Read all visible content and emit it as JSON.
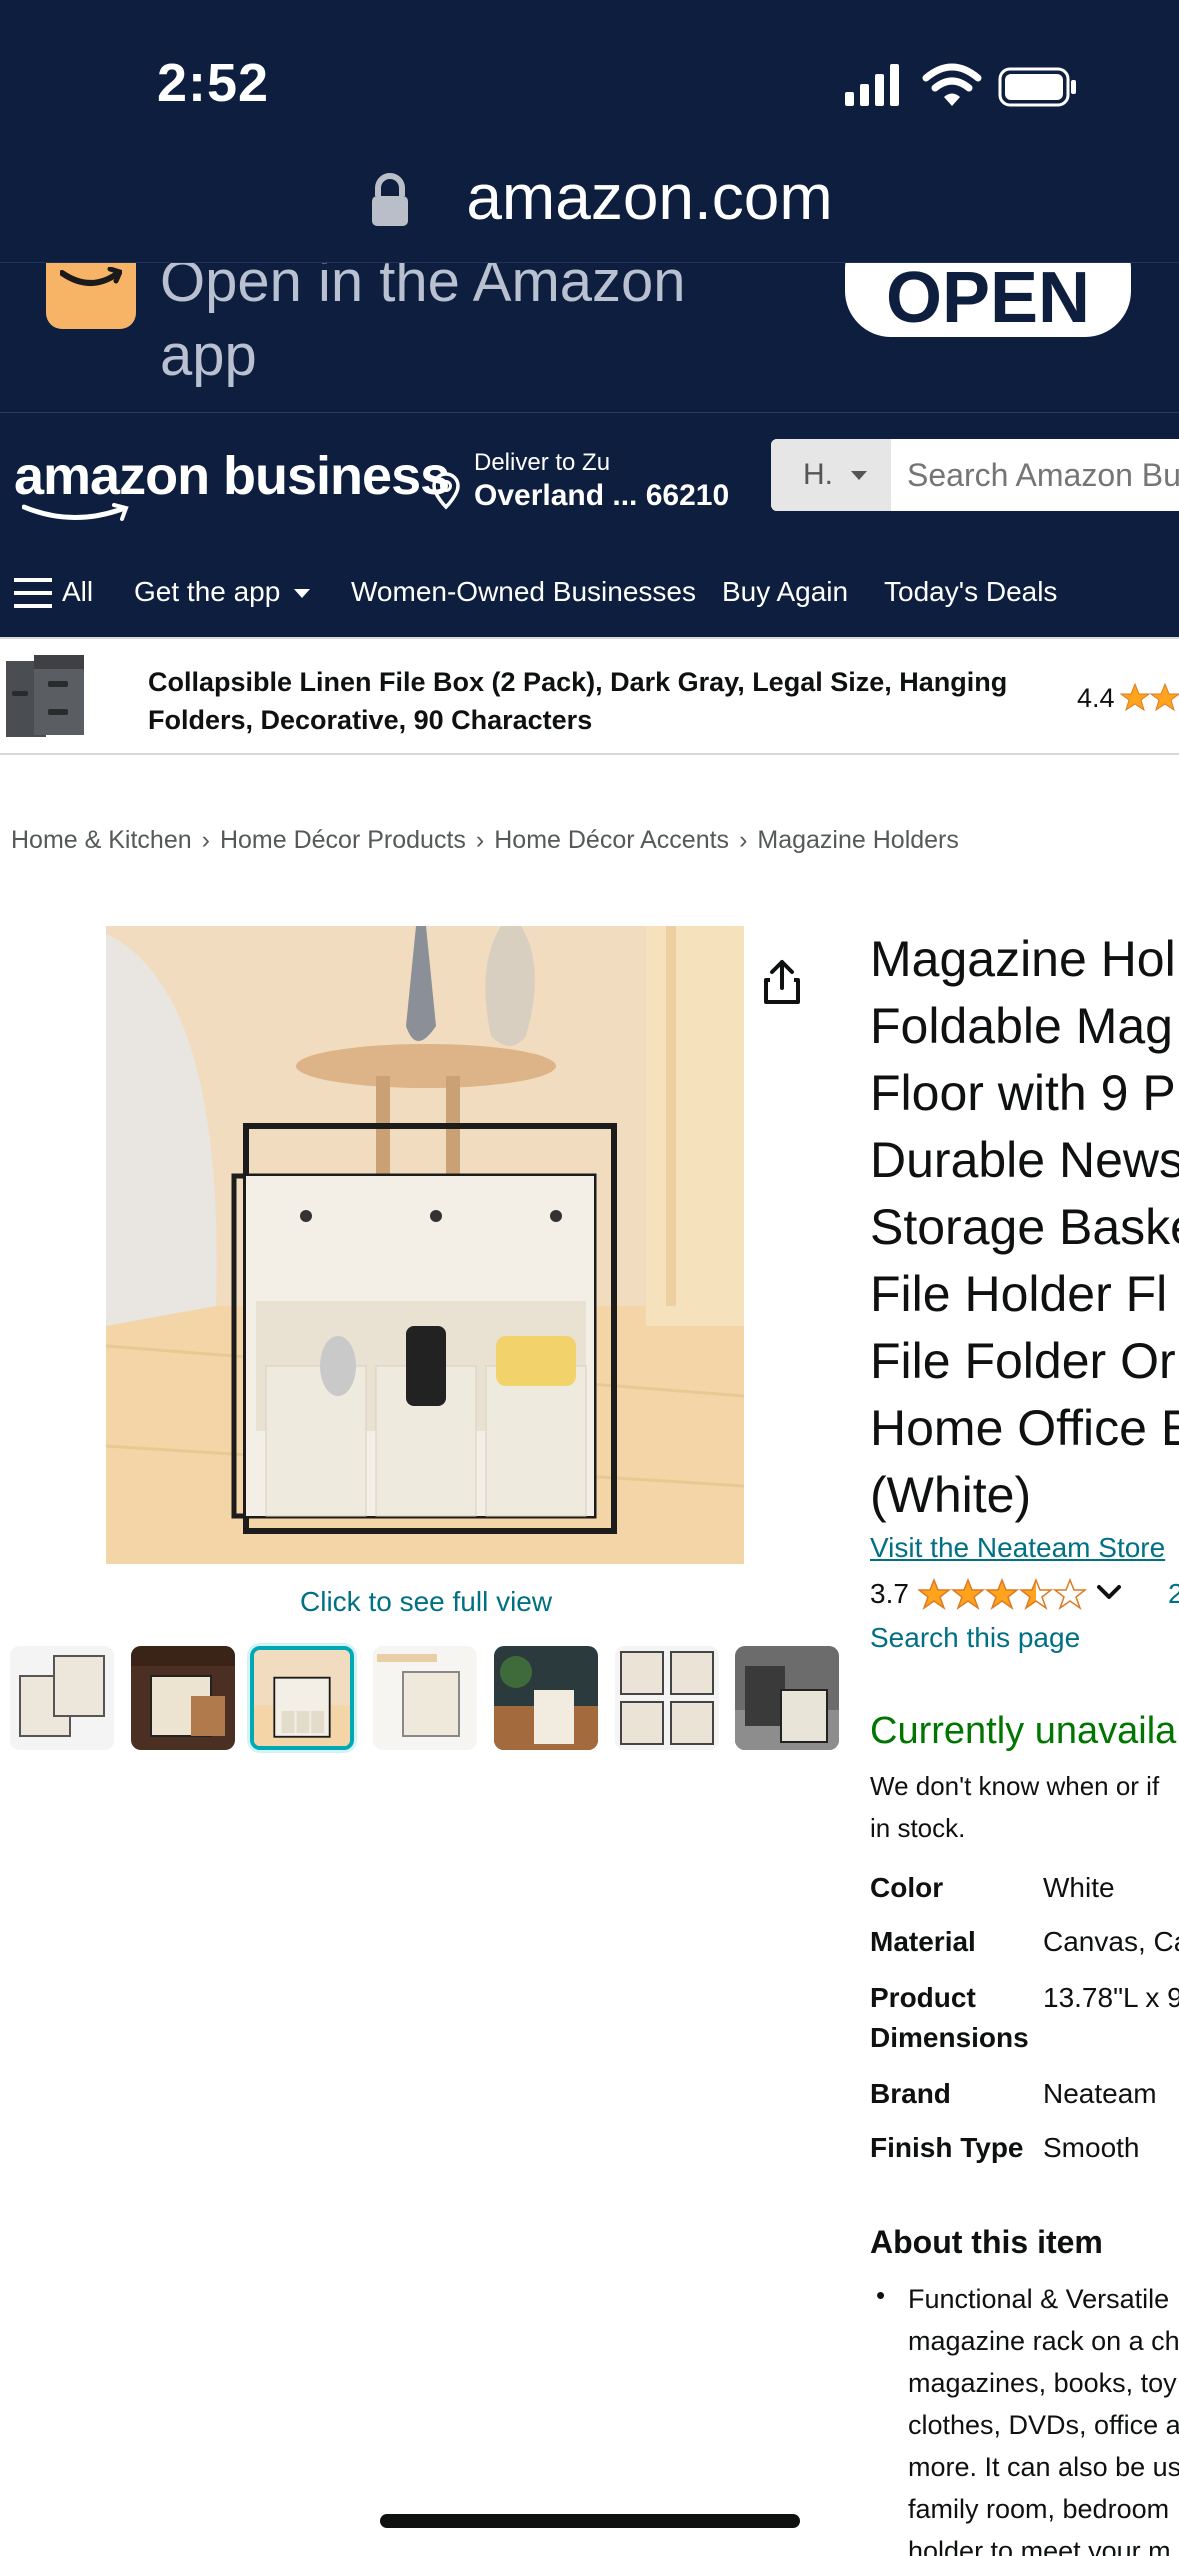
{
  "status_bar": {
    "time": "2:52"
  },
  "browser": {
    "url": "amazon.com"
  },
  "app_banner": {
    "text_line1": "Open in the Amazon",
    "text_line2": "app",
    "button": "OPEN"
  },
  "header": {
    "logo_text": "amazon business",
    "deliver_to": "Deliver to Zu",
    "location": "Overland ... 66210",
    "search_department": "H.",
    "search_placeholder": "Search Amazon Bu"
  },
  "nav": {
    "all": "All",
    "items": [
      "Get the app",
      "Women-Owned Businesses",
      "Buy Again",
      "Today's Deals"
    ]
  },
  "sticky_product": {
    "title_line1": "Collapsible Linen File Box (2 Pack), Dark Gray, Legal Size, Hanging",
    "title_line2": "Folders, Decorative, 90 Characters",
    "rating": "4.4"
  },
  "breadcrumb": [
    "Home & Kitchen",
    "Home Décor Products",
    "Home Décor Accents",
    "Magazine Holders"
  ],
  "product": {
    "title_lines": [
      "Magazine Hol",
      "Foldable Mag",
      "Floor with 9 P",
      "Durable News",
      "Storage Baske",
      "File Holder Fl",
      "File Folder Or",
      "Home Office E",
      "(White)"
    ],
    "full_view": "Click to see full view",
    "store_link": "Visit the Neateam Store",
    "rating": "3.7",
    "rating_value": 3.7,
    "rating_count": "2",
    "search_page": "Search this page",
    "availability": "Currently unavaila",
    "availability_desc_line1": "We don't know when or if",
    "availability_desc_line2": "in stock."
  },
  "specs": [
    {
      "label": "Color",
      "value": "White"
    },
    {
      "label": "Material",
      "value": "Canvas, Ca"
    },
    {
      "label": "Product Dimensions",
      "value": "13.78\"L x 9"
    },
    {
      "label": "Brand",
      "value": "Neateam"
    },
    {
      "label": "Finish Type",
      "value": "Smooth"
    }
  ],
  "about": {
    "title": "About this item",
    "lines": [
      "Functional & Versatile",
      "magazine rack on a ch",
      "magazines, books, toy",
      "clothes, DVDs, office a",
      "more. It can also be us",
      "family room, bedroom",
      "holder to meet your m"
    ]
  },
  "colors": {
    "dark_navy": "#0e1e3f",
    "link": "#007185",
    "star": "#ffa41c",
    "green": "#007600"
  }
}
